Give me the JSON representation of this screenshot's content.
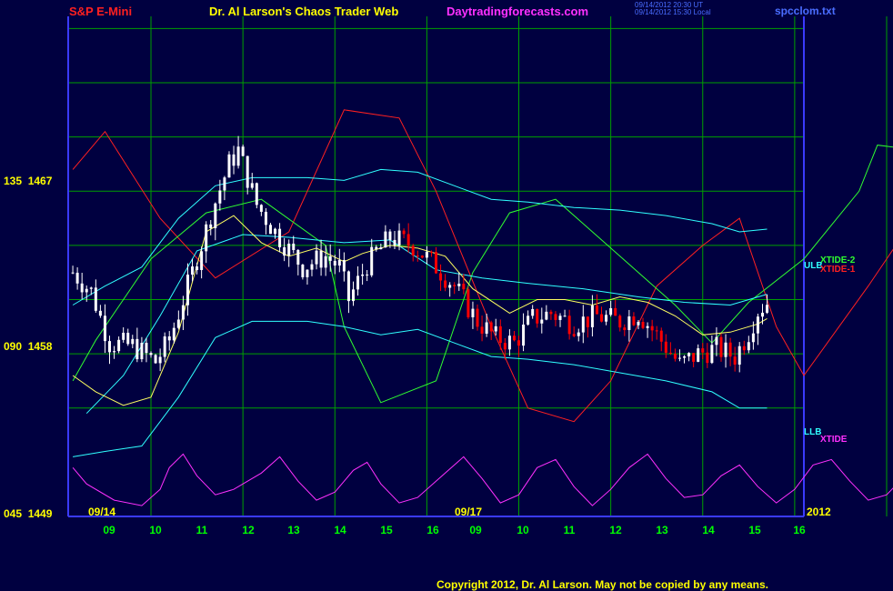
{
  "header": {
    "left": "S&P E-Mini",
    "center": "Dr. Al Larson's Chaos Trader Web",
    "site": "Daytradingforecasts.com",
    "stamp1": "09/14/2012 20:30 UT",
    "stamp2": "09/14/2012 15:30 Local",
    "file": "spcclom.txt"
  },
  "footer": {
    "copyright": "Copyright 2012, Dr. Al Larson. May not be copied by any means."
  },
  "colors": {
    "background": "#000040",
    "grid": "#00a000",
    "border": "#3a3aff",
    "axis_text": "#ffff00",
    "date_text": "#00ff00",
    "price": "#ffffff",
    "price_down": "#ff0000",
    "xtide1": "#ff2020",
    "xtide2": "#30ff30",
    "xtide": "#ff30ff",
    "bands": "#30ffff",
    "ma": "#ffff60"
  },
  "chart_data": {
    "type": "line",
    "y_labels": [
      {
        "left": "135",
        "right": "1467",
        "price": 1467
      },
      {
        "left": "090",
        "right": "1458",
        "price": 1458
      },
      {
        "left": "045",
        "right": "1449",
        "price": 1449
      }
    ],
    "ylim": [
      1449,
      1467.45
    ],
    "y_gridlines": [
      1469,
      1467,
      1465,
      1463,
      1461,
      1459,
      1457,
      1455,
      1453
    ],
    "xlim": [
      8.1,
      16.1
    ],
    "x_gridlines": [
      9,
      10,
      11,
      12,
      13,
      14,
      15,
      16
    ],
    "xaxis_dates": [
      "09",
      "10",
      "11",
      "12",
      "13",
      "14",
      "15",
      "16"
    ],
    "segments": [
      {
        "label": "09/14",
        "day": "09/14"
      },
      {
        "label": "09/17",
        "day": "09/17"
      }
    ],
    "year_label": "2012",
    "right_labels": [
      {
        "text": "ULB",
        "color": "#30ffff"
      },
      {
        "text": "XTIDE-2",
        "color": "#30ff30"
      },
      {
        "text": "XTIDE-1",
        "color": "#ff2020"
      },
      {
        "text": "LLB",
        "color": "#30ffff"
      },
      {
        "text": "XTIDE",
        "color": "#ff30ff"
      }
    ],
    "series": [
      {
        "name": "XTIDE-1",
        "color": "#ff2020",
        "points": [
          [
            0.05,
            1461.8
          ],
          [
            0.4,
            1463.2
          ],
          [
            1.0,
            1460
          ],
          [
            1.6,
            1457.8
          ],
          [
            2.4,
            1459.5
          ],
          [
            3.0,
            1464
          ],
          [
            3.6,
            1463.7
          ],
          [
            4.0,
            1461
          ],
          [
            4.6,
            1456
          ],
          [
            5.0,
            1453
          ],
          [
            5.5,
            1452.5
          ],
          [
            5.9,
            1454
          ],
          [
            6.4,
            1457.5
          ],
          [
            6.9,
            1459
          ],
          [
            7.3,
            1460
          ],
          [
            7.7,
            1456
          ],
          [
            8.0,
            1454.2
          ],
          [
            8.7,
            1457.5
          ],
          [
            9.0,
            1459
          ],
          [
            9.7,
            1459.8
          ],
          [
            10.2,
            1455.5
          ],
          [
            10.8,
            1454
          ],
          [
            11.4,
            1457
          ],
          [
            11.8,
            1458.5
          ],
          [
            12.3,
            1460.6
          ],
          [
            12.55,
            1461.1
          ],
          [
            13.1,
            1457.5
          ],
          [
            13.9,
            1454.8
          ],
          [
            14.3,
            1456.2
          ],
          [
            14.8,
            1458.6
          ],
          [
            15.5,
            1460.5
          ],
          [
            15.7,
            1460.7
          ],
          [
            16.0,
            1460.6
          ]
        ]
      },
      {
        "name": "XTIDE-2",
        "color": "#30ff30",
        "points": [
          [
            0.05,
            1454
          ],
          [
            0.3,
            1455.5
          ],
          [
            0.9,
            1458.5
          ],
          [
            1.5,
            1460.2
          ],
          [
            2.1,
            1460.7
          ],
          [
            2.8,
            1459
          ],
          [
            3.0,
            1456
          ],
          [
            3.4,
            1453.2
          ],
          [
            4.0,
            1454
          ],
          [
            4.4,
            1458
          ],
          [
            4.8,
            1460.2
          ],
          [
            5.3,
            1460.7
          ],
          [
            5.6,
            1459.8
          ],
          [
            6.1,
            1458.3
          ],
          [
            6.6,
            1456.8
          ],
          [
            7.0,
            1455.4
          ],
          [
            7.4,
            1456.9
          ],
          [
            8.0,
            1458.5
          ],
          [
            8.6,
            1461
          ],
          [
            8.8,
            1462.7
          ],
          [
            9.5,
            1462.4
          ],
          [
            9.8,
            1460.2
          ],
          [
            10.3,
            1459.8
          ],
          [
            11.0,
            1458.3
          ],
          [
            11.4,
            1457.5
          ],
          [
            11.8,
            1456
          ],
          [
            12.5,
            1455.4
          ],
          [
            12.9,
            1457
          ],
          [
            13.7,
            1458.8
          ],
          [
            14.1,
            1460
          ],
          [
            14.5,
            1461.3
          ],
          [
            15.3,
            1461.8
          ],
          [
            15.8,
            1459.2
          ],
          [
            16.1,
            1458.4
          ]
        ]
      },
      {
        "name": "XTIDE",
        "color": "#ff30ff",
        "points": [
          [
            0.05,
            1450.8
          ],
          [
            0.2,
            1450.2
          ],
          [
            0.5,
            1449.6
          ],
          [
            0.8,
            1449.4
          ],
          [
            1.0,
            1450
          ],
          [
            1.1,
            1450.8
          ],
          [
            1.25,
            1451.3
          ],
          [
            1.4,
            1450.5
          ],
          [
            1.6,
            1449.8
          ],
          [
            1.8,
            1450
          ],
          [
            2.1,
            1450.6
          ],
          [
            2.3,
            1451.2
          ],
          [
            2.5,
            1450.3
          ],
          [
            2.7,
            1449.6
          ],
          [
            2.9,
            1449.9
          ],
          [
            3.1,
            1450.7
          ],
          [
            3.25,
            1451
          ],
          [
            3.4,
            1450.2
          ],
          [
            3.6,
            1449.5
          ],
          [
            3.8,
            1449.7
          ],
          [
            4.1,
            1450.6
          ],
          [
            4.3,
            1451.2
          ],
          [
            4.5,
            1450.4
          ],
          [
            4.7,
            1449.5
          ],
          [
            4.9,
            1449.8
          ],
          [
            5.1,
            1450.8
          ],
          [
            5.3,
            1451.1
          ],
          [
            5.5,
            1450.1
          ],
          [
            5.7,
            1449.4
          ],
          [
            5.9,
            1450
          ],
          [
            6.1,
            1450.8
          ],
          [
            6.3,
            1451.3
          ],
          [
            6.5,
            1450.4
          ],
          [
            6.7,
            1449.7
          ],
          [
            6.9,
            1449.8
          ],
          [
            7.1,
            1450.5
          ],
          [
            7.3,
            1450.9
          ],
          [
            7.5,
            1450.1
          ],
          [
            7.7,
            1449.5
          ],
          [
            7.9,
            1450
          ],
          [
            8.1,
            1450.9
          ],
          [
            8.3,
            1451.1
          ],
          [
            8.5,
            1450.3
          ],
          [
            8.7,
            1449.6
          ],
          [
            8.9,
            1449.8
          ],
          [
            9.1,
            1450.5
          ],
          [
            9.3,
            1450.9
          ],
          [
            9.5,
            1450.2
          ],
          [
            9.7,
            1449.6
          ],
          [
            9.9,
            1449.9
          ],
          [
            10.1,
            1450.6
          ],
          [
            10.3,
            1450.9
          ],
          [
            10.5,
            1450.1
          ],
          [
            10.7,
            1449.5
          ],
          [
            10.9,
            1449.7
          ],
          [
            11.1,
            1450.5
          ],
          [
            11.3,
            1450.8
          ],
          [
            11.5,
            1450
          ],
          [
            11.7,
            1449.4
          ],
          [
            11.9,
            1449.7
          ],
          [
            12.1,
            1450.4
          ],
          [
            12.3,
            1450.9
          ],
          [
            12.5,
            1450.1
          ],
          [
            12.7,
            1449.5
          ],
          [
            12.9,
            1449.8
          ],
          [
            13.1,
            1450.6
          ],
          [
            13.3,
            1451
          ],
          [
            13.5,
            1450.2
          ],
          [
            13.7,
            1449.6
          ],
          [
            13.9,
            1450
          ],
          [
            14.1,
            1451.2
          ],
          [
            14.3,
            1451.5
          ],
          [
            14.5,
            1450.6
          ],
          [
            14.7,
            1449.8
          ],
          [
            14.9,
            1449.9
          ],
          [
            15.1,
            1450.8
          ],
          [
            15.3,
            1451.2
          ],
          [
            15.5,
            1450.3
          ],
          [
            15.7,
            1449.6
          ],
          [
            15.9,
            1450.2
          ],
          [
            16.0,
            1451
          ],
          [
            16.1,
            1451.8
          ]
        ]
      },
      {
        "name": "ULB",
        "color": "#30ffff",
        "points": [
          [
            0.05,
            1456.8
          ],
          [
            0.4,
            1457.5
          ],
          [
            0.8,
            1458.2
          ],
          [
            1.2,
            1460
          ],
          [
            1.6,
            1461.2
          ],
          [
            2.0,
            1461.5
          ],
          [
            2.6,
            1461.5
          ],
          [
            3.0,
            1461.4
          ],
          [
            3.4,
            1461.8
          ],
          [
            3.8,
            1461.7
          ],
          [
            4.2,
            1461.2
          ],
          [
            4.6,
            1460.7
          ],
          [
            5.0,
            1460.6
          ],
          [
            5.5,
            1460.4
          ],
          [
            6.0,
            1460.3
          ],
          [
            6.5,
            1460.1
          ],
          [
            7.0,
            1459.8
          ],
          [
            7.3,
            1459.5
          ],
          [
            7.6,
            1459.6
          ]
        ]
      },
      {
        "name": "LLB",
        "color": "#30ffff",
        "points": [
          [
            0.05,
            1451.2
          ],
          [
            0.4,
            1451.4
          ],
          [
            0.8,
            1451.6
          ],
          [
            1.2,
            1453.4
          ],
          [
            1.6,
            1455.6
          ],
          [
            2.0,
            1456.2
          ],
          [
            2.6,
            1456.2
          ],
          [
            3.0,
            1456
          ],
          [
            3.4,
            1455.7
          ],
          [
            3.8,
            1455.9
          ],
          [
            4.2,
            1455.4
          ],
          [
            4.6,
            1454.9
          ],
          [
            5.0,
            1454.8
          ],
          [
            5.5,
            1454.6
          ],
          [
            6.0,
            1454.3
          ],
          [
            6.5,
            1454
          ],
          [
            7.0,
            1453.6
          ],
          [
            7.3,
            1453
          ],
          [
            7.6,
            1453
          ]
        ]
      },
      {
        "name": "MID",
        "color": "#30ffff",
        "points": [
          [
            0.2,
            1452.8
          ],
          [
            0.6,
            1454.2
          ],
          [
            1.0,
            1456.4
          ],
          [
            1.4,
            1458.8
          ],
          [
            1.9,
            1459.4
          ],
          [
            2.4,
            1459.3
          ],
          [
            3.0,
            1459.1
          ],
          [
            3.5,
            1459.2
          ],
          [
            4.0,
            1458.1
          ],
          [
            4.5,
            1457.8
          ],
          [
            5.0,
            1457.6
          ],
          [
            5.6,
            1457.4
          ],
          [
            6.2,
            1457.1
          ],
          [
            6.7,
            1456.9
          ],
          [
            7.2,
            1456.8
          ],
          [
            7.6,
            1457.2
          ]
        ]
      },
      {
        "name": "MA",
        "color": "#ffff60",
        "points": [
          [
            0.05,
            1454.2
          ],
          [
            0.3,
            1453.6
          ],
          [
            0.6,
            1453.1
          ],
          [
            0.9,
            1453.4
          ],
          [
            1.2,
            1455.8
          ],
          [
            1.5,
            1459.5
          ],
          [
            1.8,
            1460.1
          ],
          [
            2.1,
            1459.1
          ],
          [
            2.4,
            1458.6
          ],
          [
            2.7,
            1458.9
          ],
          [
            3.0,
            1458.4
          ],
          [
            3.2,
            1458.7
          ],
          [
            3.5,
            1459
          ],
          [
            3.8,
            1458.9
          ],
          [
            4.1,
            1458.6
          ],
          [
            4.4,
            1457.4
          ],
          [
            4.8,
            1456.5
          ],
          [
            5.1,
            1457
          ],
          [
            5.4,
            1457
          ],
          [
            5.7,
            1456.8
          ],
          [
            6.0,
            1457.1
          ],
          [
            6.3,
            1456.9
          ],
          [
            6.6,
            1456.4
          ],
          [
            6.9,
            1455.7
          ],
          [
            7.2,
            1455.8
          ],
          [
            7.5,
            1456.1
          ],
          [
            7.6,
            1456.3
          ]
        ]
      }
    ],
    "price": {
      "candle_days": [
        8.05,
        9.6
      ],
      "keypoints": [
        [
          0.05,
          1458
        ],
        [
          0.25,
          1457.3
        ],
        [
          0.45,
          1455.4
        ],
        [
          0.7,
          1455.3
        ],
        [
          0.95,
          1454.7
        ],
        [
          1.1,
          1455.5
        ],
        [
          1.35,
          1458
        ],
        [
          1.6,
          1460.6
        ],
        [
          1.75,
          1462
        ],
        [
          1.85,
          1462.5
        ],
        [
          2.05,
          1460.5
        ],
        [
          2.25,
          1459.5
        ],
        [
          2.55,
          1458.2
        ],
        [
          2.8,
          1458.6
        ],
        [
          2.95,
          1458.2
        ],
        [
          3.05,
          1457
        ],
        [
          3.25,
          1458.3
        ],
        [
          3.5,
          1459.3
        ],
        [
          3.75,
          1459
        ],
        [
          3.95,
          1458.4
        ],
        [
          4.2,
          1457.5
        ],
        [
          4.45,
          1456.2
        ],
        [
          4.65,
          1455.6
        ],
        [
          4.85,
          1455.4
        ],
        [
          5.05,
          1456.3
        ],
        [
          5.25,
          1456.5
        ],
        [
          5.5,
          1456.1
        ],
        [
          5.75,
          1456.4
        ],
        [
          6.0,
          1456.2
        ],
        [
          6.2,
          1456.5
        ],
        [
          6.4,
          1455.7
        ],
        [
          6.65,
          1454.6
        ],
        [
          6.85,
          1455
        ],
        [
          7.05,
          1455.2
        ],
        [
          7.25,
          1454.9
        ],
        [
          7.4,
          1455.8
        ],
        [
          7.5,
          1456.6
        ],
        [
          7.6,
          1456.9
        ]
      ]
    }
  }
}
